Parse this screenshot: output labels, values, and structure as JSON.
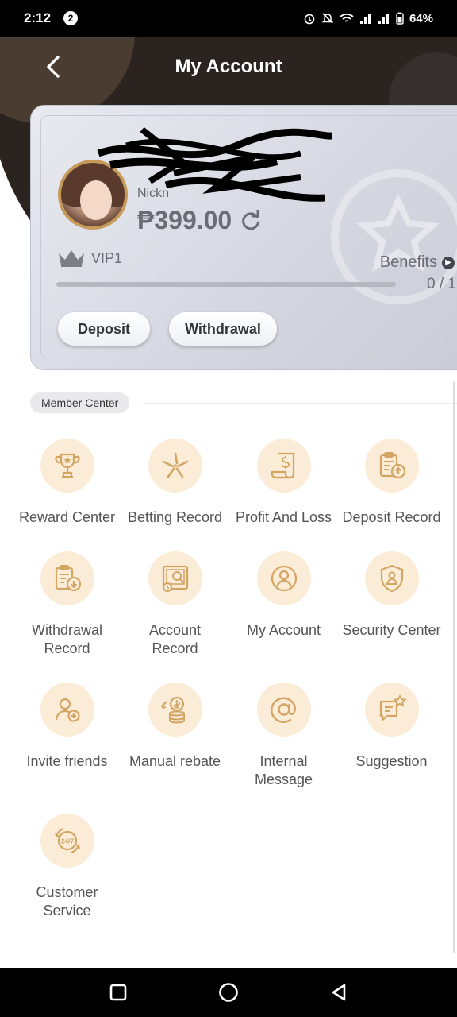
{
  "status_bar": {
    "time": "2:12",
    "notification_count": "2",
    "battery": "64%"
  },
  "header": {
    "title": "My Account"
  },
  "account": {
    "username": "",
    "nickname_label": "Nickn",
    "balance": "₱399.00",
    "vip_level": "VIP1",
    "benefits_label": "Benefits",
    "progress_text": "0 / 1",
    "progress_fraction": 0,
    "deposit_label": "Deposit",
    "withdrawal_label": "Withdrawal"
  },
  "member_center": {
    "title": "Member Center",
    "items": [
      {
        "label": "Reward Center",
        "icon": "trophy-icon"
      },
      {
        "label": "Betting Record",
        "icon": "betting-icon"
      },
      {
        "label": "Profit And Loss",
        "icon": "profit-loss-icon"
      },
      {
        "label": "Deposit Record",
        "icon": "deposit-record-icon"
      },
      {
        "label": "Withdrawal Record",
        "icon": "withdrawal-record-icon"
      },
      {
        "label": "Account Record",
        "icon": "account-record-icon"
      },
      {
        "label": "My Account",
        "icon": "user-icon"
      },
      {
        "label": "Security Center",
        "icon": "shield-icon"
      },
      {
        "label": "Invite friends",
        "icon": "invite-icon"
      },
      {
        "label": "Manual rebate",
        "icon": "rebate-icon"
      },
      {
        "label": "Internal Message",
        "icon": "at-icon"
      },
      {
        "label": "Suggestion",
        "icon": "suggestion-icon"
      },
      {
        "label": "Customer Service",
        "icon": "service-247-icon"
      }
    ]
  },
  "colors": {
    "accent": "#d4a86a",
    "icon_bg": "#fbecd7",
    "header_bg": "#2b2320"
  }
}
